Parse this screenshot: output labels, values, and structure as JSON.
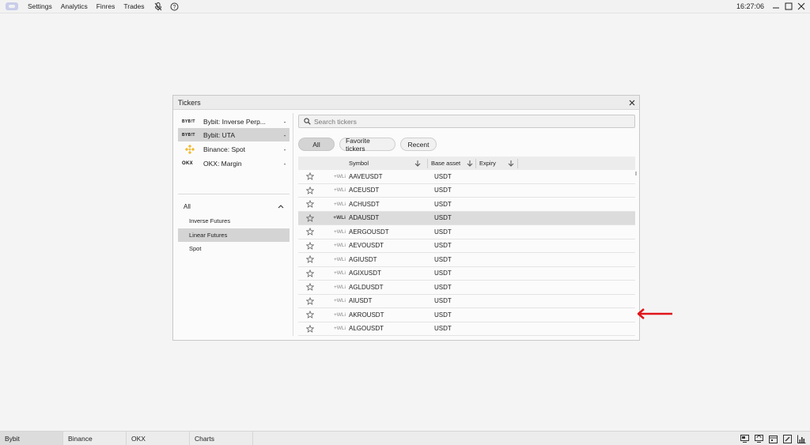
{
  "topbar": {
    "menu": [
      "Settings",
      "Analytics",
      "Finres",
      "Trades"
    ],
    "icons": [
      "mute-mic-icon",
      "help-icon"
    ],
    "clock": "16:27:06",
    "window_buttons": [
      "minimize-icon",
      "maximize-icon",
      "close-icon"
    ]
  },
  "dialog": {
    "title": "Tickers",
    "exchanges": [
      {
        "logo": "BYB!T",
        "name": "Bybit: Inverse Perp...",
        "marker": "-",
        "selected": false
      },
      {
        "logo": "BYB!T",
        "name": "Bybit: UTA",
        "marker": "-",
        "selected": true
      },
      {
        "logo": "binance-logo",
        "name": "Binance: Spot",
        "marker": "-",
        "selected": false
      },
      {
        "logo": "OKX",
        "name": "OKX: Margin",
        "marker": "-",
        "selected": false
      }
    ],
    "categories_header": "All",
    "categories": [
      {
        "label": "Inverse Futures",
        "selected": false
      },
      {
        "label": "Linear Futures",
        "selected": true
      },
      {
        "label": "Spot",
        "selected": false
      }
    ],
    "search_placeholder": "Search tickers",
    "filters": [
      {
        "label": "All",
        "active": true
      },
      {
        "label": "Favorite tickers",
        "active": false
      },
      {
        "label": "Recent",
        "active": false
      }
    ],
    "columns": {
      "symbol": "Symbol",
      "base_asset": "Base asset",
      "expiry": "Expiry"
    },
    "add_label": "+WLi",
    "rows": [
      {
        "symbol": "AAVEUSDT",
        "base": "USDT"
      },
      {
        "symbol": "ACEUSDT",
        "base": "USDT"
      },
      {
        "symbol": "ACHUSDT",
        "base": "USDT"
      },
      {
        "symbol": "ADAUSDT",
        "base": "USDT",
        "highlight": true
      },
      {
        "symbol": "AERGOUSDT",
        "base": "USDT"
      },
      {
        "symbol": "AEVOUSDT",
        "base": "USDT"
      },
      {
        "symbol": "AGIUSDT",
        "base": "USDT"
      },
      {
        "symbol": "AGIXUSDT",
        "base": "USDT"
      },
      {
        "symbol": "AGLDUSDT",
        "base": "USDT"
      },
      {
        "symbol": "AIUSDT",
        "base": "USDT"
      },
      {
        "symbol": "AKROUSDT",
        "base": "USDT"
      },
      {
        "symbol": "ALGOUSDT",
        "base": "USDT"
      }
    ],
    "annotation_color": "#e0141a"
  },
  "bottombar": {
    "tabs": [
      {
        "label": "Bybit",
        "active": true
      },
      {
        "label": "Binance",
        "active": false
      },
      {
        "label": "OKX",
        "active": false
      },
      {
        "label": "Charts",
        "active": false
      }
    ],
    "icons": [
      "screen-icon",
      "sync-icon",
      "calendar-icon",
      "edit-icon",
      "stats-icon"
    ]
  }
}
